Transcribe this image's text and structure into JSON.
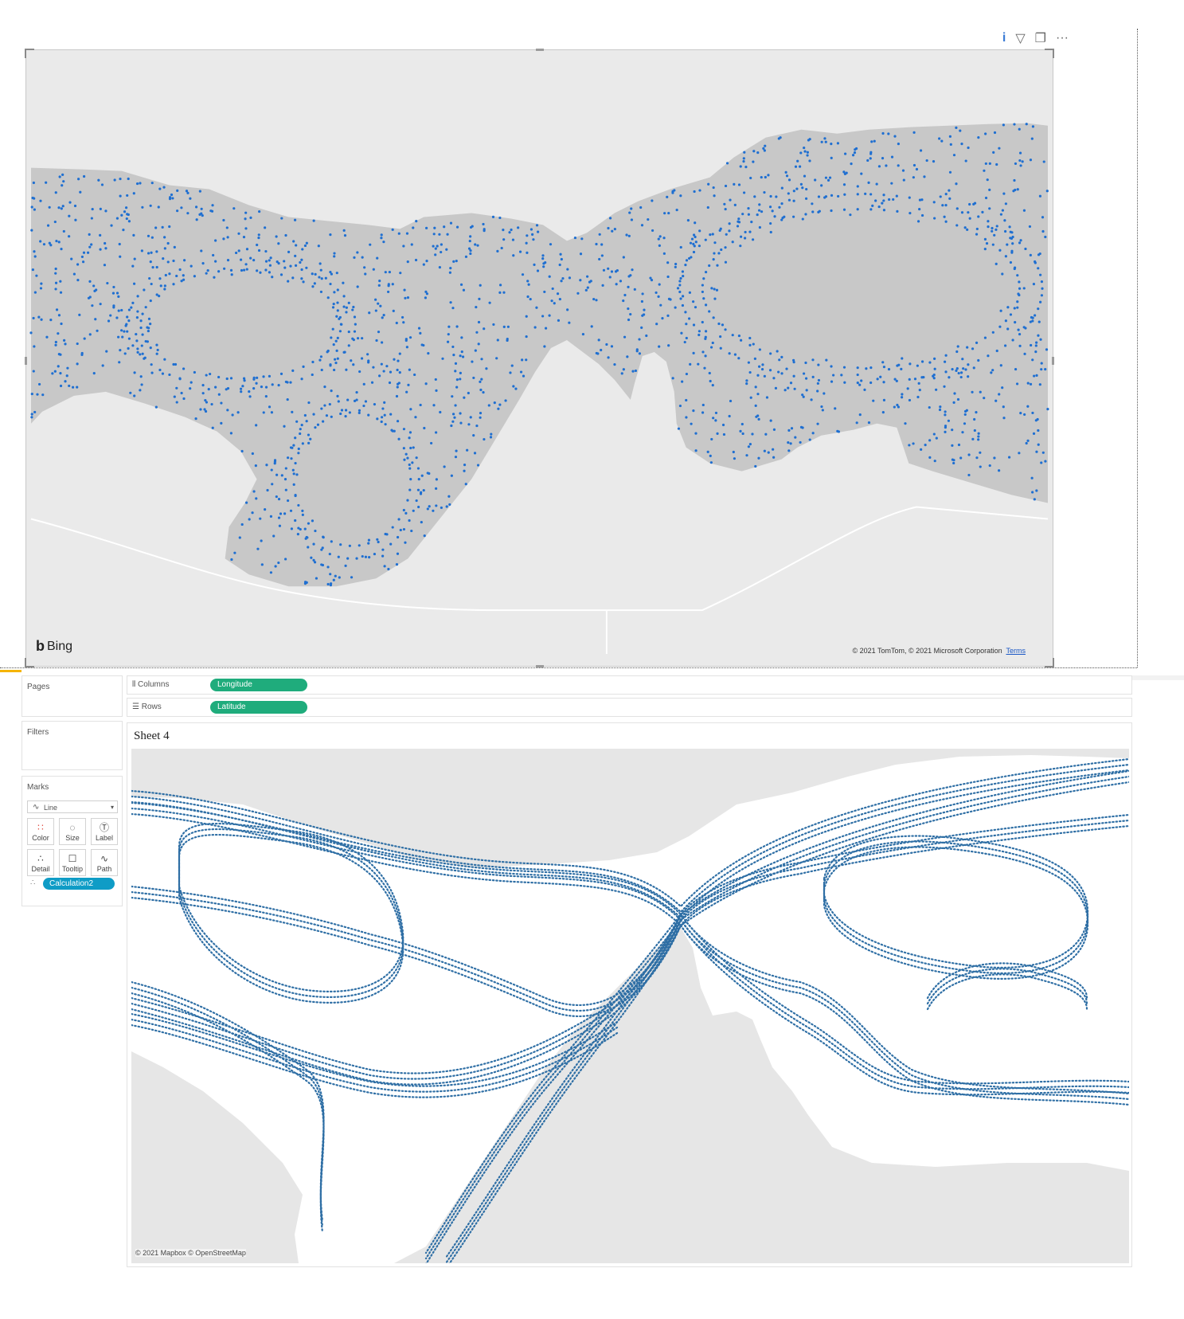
{
  "pbi": {
    "info_icon": "i",
    "filter_icon": "filter-icon",
    "focus_icon": "focus-mode-icon",
    "more_icon": "···",
    "bing_label": "Bing",
    "attribution": "© 2021 TomTom, © 2021 Microsoft Corporation",
    "terms_link": "Terms",
    "colors": {
      "land": "#eaeaea",
      "water": "#c8c8c8",
      "dot": "#1f6fd1"
    }
  },
  "tableau": {
    "pages_label": "Pages",
    "filters_label": "Filters",
    "marks_label": "Marks",
    "columns_label": "Columns",
    "rows_label": "Rows",
    "columns_pill": "Longitude",
    "rows_pill": "Latitude",
    "mark_type": "Line",
    "mark_buttons": [
      {
        "label": "Color",
        "icon": "color-icon"
      },
      {
        "label": "Size",
        "icon": "size-icon"
      },
      {
        "label": "Label",
        "icon": "label-icon"
      },
      {
        "label": "Detail",
        "icon": "detail-icon"
      },
      {
        "label": "Tooltip",
        "icon": "tooltip-icon"
      },
      {
        "label": "Path",
        "icon": "path-icon"
      }
    ],
    "calc_pill": "Calculation2",
    "sheet_title": "Sheet 4",
    "attribution": "© 2021 Mapbox © OpenStreetMap",
    "colors": {
      "land": "#e6e6e6",
      "water": "#ffffff",
      "line": "#2f6fa5",
      "pill_green": "#1fac7c",
      "pill_blue": "#0f9cc6"
    }
  }
}
